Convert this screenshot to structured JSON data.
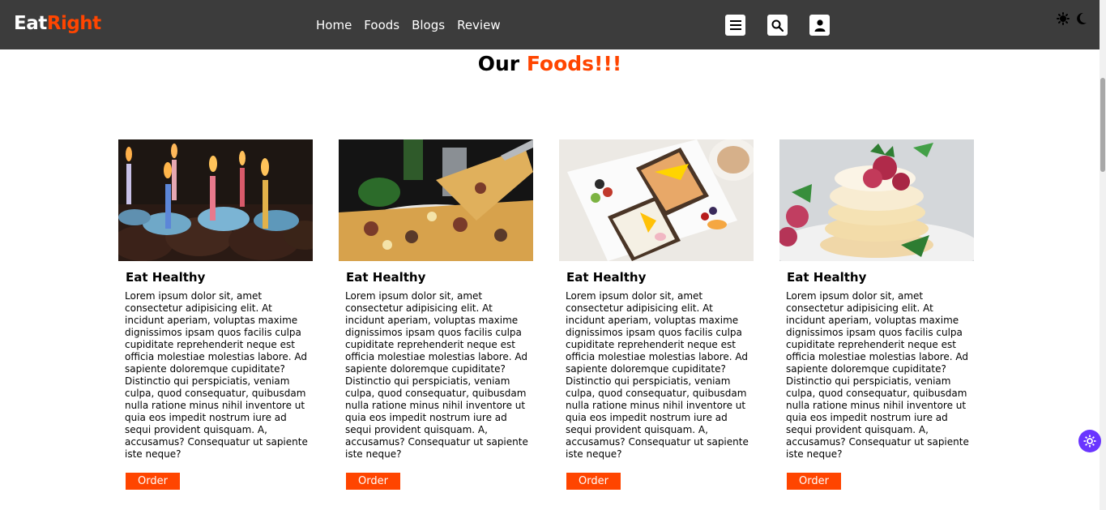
{
  "brand": {
    "part1": "Eat",
    "part2": "Right"
  },
  "nav": {
    "links": [
      "Home",
      "Foods",
      "Blogs",
      "Review"
    ]
  },
  "header_icons": [
    "menu-icon",
    "search-icon",
    "user-icon"
  ],
  "theme_icons": [
    "sun-icon",
    "moon-icon"
  ],
  "heading": {
    "part1": "Our ",
    "part2": "Foods!!!"
  },
  "colors": {
    "accent": "#ff4500",
    "navbar": "#3c3c3c",
    "fab": "#6a35ff"
  },
  "cards": [
    {
      "image": "birthday-cupcakes-image",
      "title": "Eat Healthy",
      "text": "Lorem ipsum dolor sit, amet consectetur adipisicing elit. At incidunt aperiam, voluptas maxime dignissimos ipsam quos facilis culpa cupiditate reprehenderit neque est officia molestiae molestias labore. Ad sapiente doloremque cupiditate? Distinctio qui perspiciatis, veniam culpa, quod consequatur, quibusdam nulla ratione minus nihil inventore ut quia eos impedit nostrum iure ad sequi provident quisquam. A, accusamus? Consequatur ut sapiente iste neque?",
      "button": "Order"
    },
    {
      "image": "pizza-image",
      "title": "Eat Healthy",
      "text": "Lorem ipsum dolor sit, amet consectetur adipisicing elit. At incidunt aperiam, voluptas maxime dignissimos ipsam quos facilis culpa cupiditate reprehenderit neque est officia molestiae molestias labore. Ad sapiente doloremque cupiditate? Distinctio qui perspiciatis, veniam culpa, quod consequatur, quibusdam nulla ratione minus nihil inventore ut quia eos impedit nostrum iure ad sequi provident quisquam. A, accusamus? Consequatur ut sapiente iste neque?",
      "button": "Order"
    },
    {
      "image": "toast-breakfast-image",
      "title": "Eat Healthy",
      "text": "Lorem ipsum dolor sit, amet consectetur adipisicing elit. At incidunt aperiam, voluptas maxime dignissimos ipsam quos facilis culpa cupiditate reprehenderit neque est officia molestiae molestias labore. Ad sapiente doloremque cupiditate? Distinctio qui perspiciatis, veniam culpa, quod consequatur, quibusdam nulla ratione minus nihil inventore ut quia eos impedit nostrum iure ad sequi provident quisquam. A, accusamus? Consequatur ut sapiente iste neque?",
      "button": "Order"
    },
    {
      "image": "pancakes-image",
      "title": "Eat Healthy",
      "text": "Lorem ipsum dolor sit, amet consectetur adipisicing elit. At incidunt aperiam, voluptas maxime dignissimos ipsam quos facilis culpa cupiditate reprehenderit neque est officia molestiae molestias labore. Ad sapiente doloremque cupiditate? Distinctio qui perspiciatis, veniam culpa, quod consequatur, quibusdam nulla ratione minus nihil inventore ut quia eos impedit nostrum iure ad sequi provident quisquam. A, accusamus? Consequatur ut sapiente iste neque?",
      "button": "Order"
    }
  ]
}
